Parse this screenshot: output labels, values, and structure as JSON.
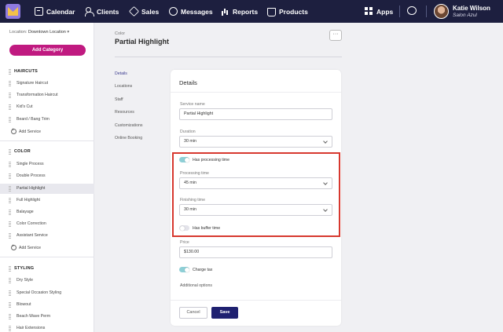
{
  "nav": {
    "items": [
      {
        "label": "Calendar",
        "icon": "calendar-icon"
      },
      {
        "label": "Clients",
        "icon": "clients-icon"
      },
      {
        "label": "Sales",
        "icon": "sales-tag-icon"
      },
      {
        "label": "Messages",
        "icon": "messages-icon"
      },
      {
        "label": "Reports",
        "icon": "reports-chart-icon"
      },
      {
        "label": "Products",
        "icon": "products-bag-icon"
      }
    ],
    "apps_label": "Apps",
    "user": {
      "name": "Katie Wilson",
      "location": "Salon Azul"
    }
  },
  "sidebar": {
    "location_label": "Location:",
    "location_value": "Downtown Location",
    "add_category": "Add Category",
    "categories": [
      {
        "name": "HAIRCUTS",
        "items": [
          "Signature Haircut",
          "Transformation Haircut",
          "Kid's Cut",
          "Beard / Bang Trim"
        ],
        "add": "Add Service"
      },
      {
        "name": "COLOR",
        "items": [
          "Single Process",
          "Double Process",
          "Partial Highlight",
          "Full Highlight",
          "Balayage",
          "Color Correction",
          "Assistant Service"
        ],
        "add": "Add Service",
        "selected": "Partial Highlight"
      },
      {
        "name": "STYLING",
        "items": [
          "Dry Style",
          "Special Occasion Styling",
          "Blowout",
          "Beach Wave Perm",
          "Hair Extensions"
        ]
      }
    ]
  },
  "header": {
    "crumb": "Color",
    "title": "Partial Highlight",
    "more": "···"
  },
  "subnav": [
    "Details",
    "Locations",
    "Staff",
    "Resources",
    "Customizations",
    "Online Booking"
  ],
  "details": {
    "title": "Details",
    "service_name_label": "Service name",
    "service_name_value": "Partial Highlight",
    "duration_label": "Duration",
    "duration_value": "30 min",
    "has_processing_label": "Has processing time",
    "has_processing_on": true,
    "processing_label": "Processing time",
    "processing_value": "45 min",
    "finishing_label": "Finishing time",
    "finishing_value": "30 min",
    "has_buffer_label": "Has buffer time",
    "has_buffer_on": false,
    "price_label": "Price",
    "price_value": "$130.00",
    "charge_tax_label": "Charge tax",
    "charge_tax_on": true,
    "additional_options": "Additional options",
    "cancel": "Cancel",
    "save": "Save"
  },
  "colors": {
    "nav_bg": "#1d1f3f",
    "accent": "#c01a80",
    "save": "#1f2170",
    "highlight": "#d7382f",
    "toggle_on": "#8ecfd6"
  }
}
